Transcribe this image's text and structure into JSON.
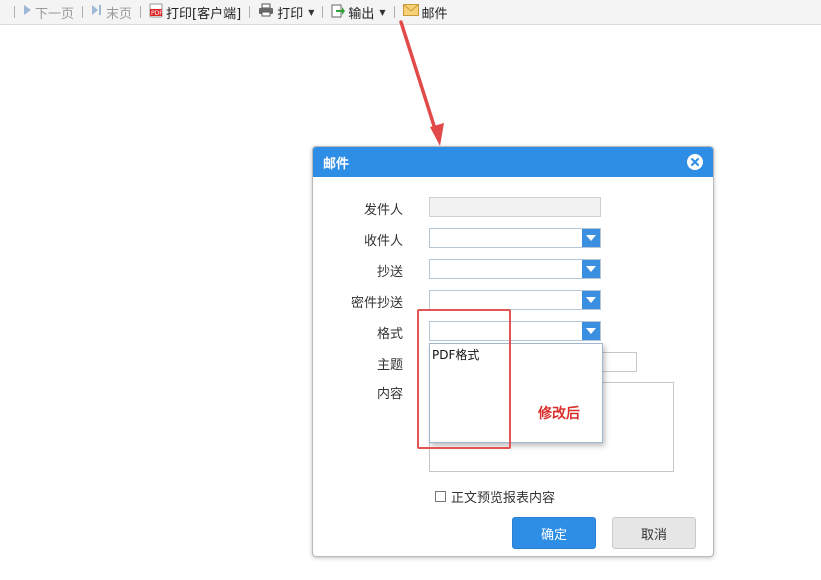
{
  "toolbar": {
    "items": [
      {
        "label": "下一页",
        "icon": "next-page-icon",
        "enabled": false
      },
      {
        "label": "末页",
        "icon": "last-page-icon",
        "enabled": false
      },
      {
        "label": "打印[客户端]",
        "icon": "pdf-print-icon",
        "enabled": true
      },
      {
        "label": "打印",
        "icon": "printer-icon",
        "enabled": true,
        "dropdown": true
      },
      {
        "label": "输出",
        "icon": "export-icon",
        "enabled": true,
        "dropdown": true
      },
      {
        "label": "邮件",
        "icon": "mail-icon",
        "enabled": true
      }
    ]
  },
  "dialog": {
    "title": "邮件",
    "fields": {
      "sender": {
        "label": "发件人",
        "value": ""
      },
      "recipient": {
        "label": "收件人",
        "value": ""
      },
      "cc": {
        "label": "抄送",
        "value": ""
      },
      "bcc": {
        "label": "密件抄送",
        "value": ""
      },
      "format": {
        "label": "格式",
        "value": "",
        "options": [
          "PDF格式"
        ]
      },
      "subject": {
        "label": "主题",
        "value": ""
      },
      "content": {
        "label": "内容",
        "value": ""
      }
    },
    "checkbox": {
      "label": "正文预览报表内容",
      "checked": false
    },
    "ok_label": "确定",
    "cancel_label": "取消"
  },
  "annotation": {
    "text": "修改后",
    "color": "#d9302c"
  },
  "colors": {
    "accent": "#2e8ee6",
    "annotation": "#e35454"
  }
}
